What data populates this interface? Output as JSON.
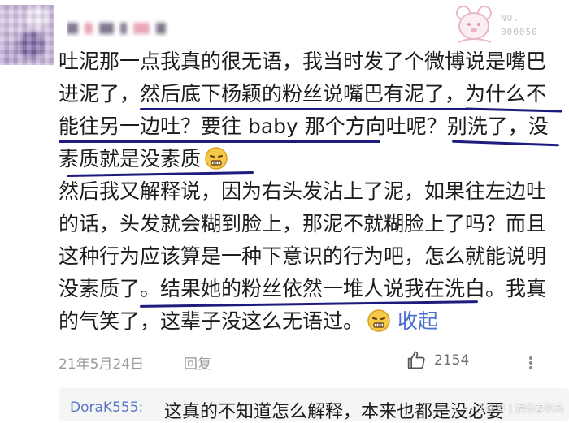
{
  "header": {
    "username": "",
    "badge": {
      "label": "NO.",
      "number": "000050"
    }
  },
  "comment": {
    "lines": [
      "吐泥那一点我真的很无语，我当时发了个微博说是嘴巴",
      "进泥了，然后底下杨颖的粉丝说嘴巴有泥了，为什么不",
      "能往另一边吐？要往 baby 那个方向吐呢？别洗了，没",
      "素质就是没素质",
      "然后我又解释说，因为右头发沾上了泥，如果往左边吐",
      "的话，头发就会糊到脸上，那泥不就糊脸上了吗？而且",
      "这种行为应该算是一种下意识的行为吧，怎么就能说明",
      "没素质了。结果她的粉丝依然一堆人说我在洗白。我真",
      "的气笑了，这辈子没这么无语过。"
    ],
    "collapse_label": "收起",
    "emoji": "speechless-face-emoji"
  },
  "meta": {
    "date": "21年5月24日",
    "reply_label": "回复",
    "like_count": "2154",
    "like_icon": "thumbs-up-icon",
    "more_icon": "more-icon"
  },
  "sub_reply": {
    "author": "DoraK555:",
    "text": "这真的不知道怎么解释，本来也都是没必要"
  },
  "watermark": "头条号 | 娱乐客长高",
  "colors": {
    "underline": "#1e1b7e",
    "link": "#4a6fd1",
    "meta": "#9a9a9a"
  }
}
